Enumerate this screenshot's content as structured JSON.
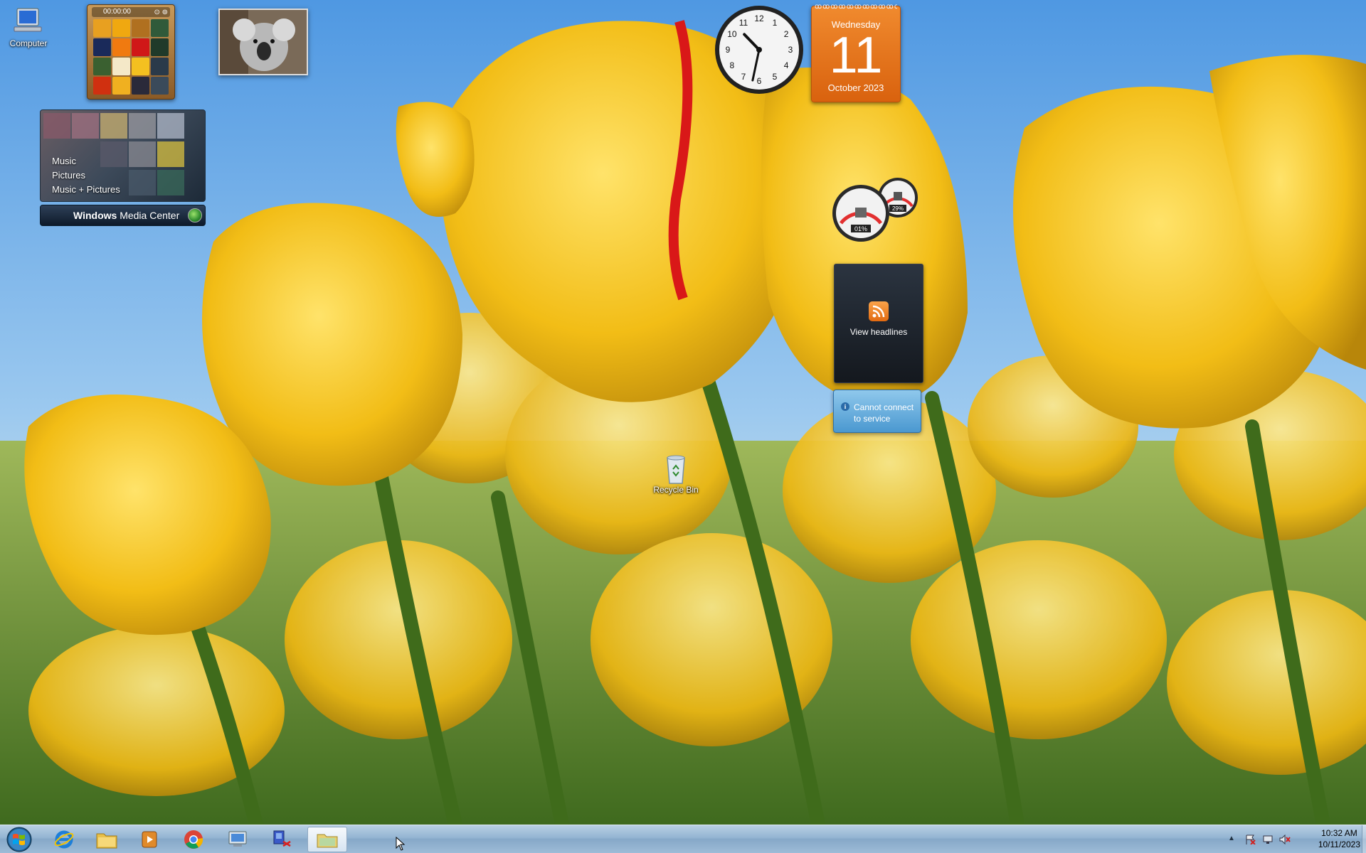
{
  "desktop": {
    "icons": [
      {
        "label": "Computer"
      },
      {
        "label": "Recycle Bin"
      }
    ]
  },
  "gadgets": {
    "puzzle": {
      "timer": "00:00:00"
    },
    "media_center": {
      "menu": [
        "Music",
        "Pictures",
        "Music + Pictures"
      ],
      "title_bold": "Windows",
      "title_rest": " Media Center"
    },
    "clock": {
      "hour": 10,
      "minute": 32
    },
    "calendar": {
      "weekday": "Wednesday",
      "day": "11",
      "month_year": "October 2023"
    },
    "cpu_meter": {
      "cpu": "01%",
      "memory": "29%"
    },
    "feed_headlines": {
      "label": "View headlines"
    },
    "weather": {
      "message_line1": "Cannot connect",
      "message_line2": "to service"
    }
  },
  "taskbar": {
    "pinned": [
      {
        "name": "internet-explorer"
      },
      {
        "name": "windows-explorer"
      },
      {
        "name": "windows-media-player"
      },
      {
        "name": "google-chrome"
      },
      {
        "name": "remote-desktop"
      },
      {
        "name": "network-tool"
      },
      {
        "name": "folder-window",
        "active": true
      }
    ]
  },
  "tray": {
    "time": "10:32 AM",
    "date": "10/11/2023"
  },
  "colors": {
    "calendar": "#e8701a",
    "taskbar": "#9dbbd7",
    "sky": "#7fb6e6",
    "tulip": "#f5c21b"
  }
}
